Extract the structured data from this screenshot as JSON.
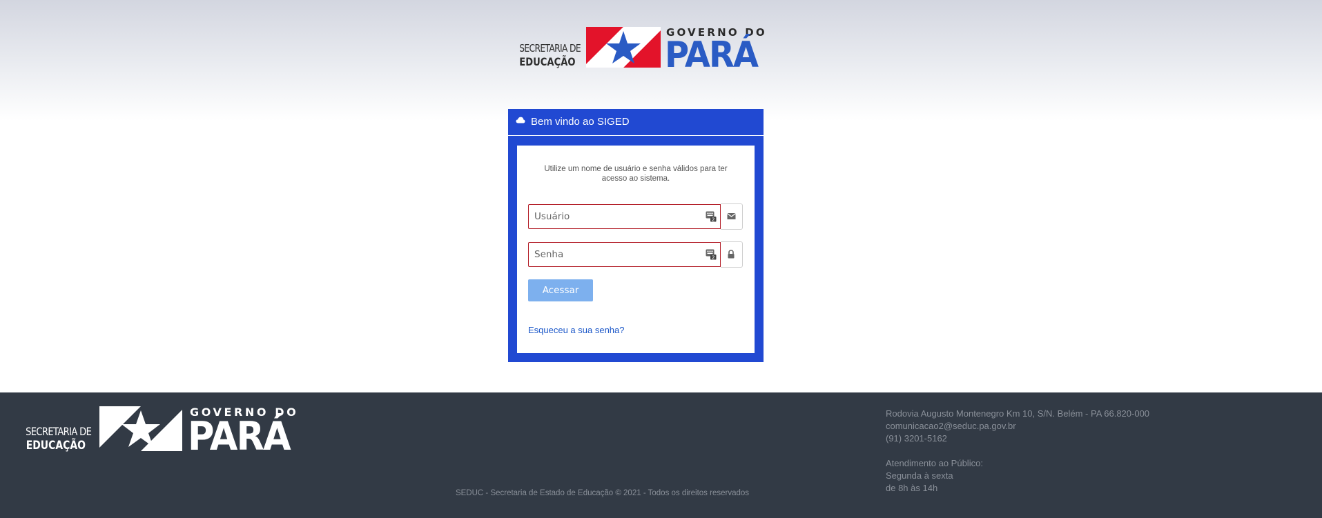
{
  "header": {
    "org_line1": "SECRETARIA DE",
    "org_line2": "EDUCAÇÃO",
    "gov_small": "GOVERNO DO",
    "gov_big": "PARÁ"
  },
  "login": {
    "title": "Bem vindo ao SIGED",
    "intro": "Utilize um nome de usuário e senha válidos para ter acesso ao sistema.",
    "username_placeholder": "Usuário",
    "password_placeholder": "Senha",
    "submit_label": "Acessar",
    "forgot_link": "Esqueceu a sua senha?"
  },
  "footer": {
    "org_line1": "SECRETARIA DE",
    "org_line2": "EDUCAÇÃO",
    "gov_small": "GOVERNO DO",
    "gov_big": "PARÁ",
    "address": "Rodovia Augusto Montenegro Km 10, S/N. Belém - PA 66.820-000",
    "email": "comunicacao2@seduc.pa.gov.br",
    "phone": "(91) 3201-5162",
    "hours_title": "Atendimento ao Público:",
    "hours_days": "Segunda à sexta",
    "hours_time": "de 8h às 14h",
    "copyright": "SEDUC - Secretaria de Estado de Educação © 2021 - Todos os direitos reservados"
  },
  "colors": {
    "panel": "#2149d2",
    "button": "#7db0ee",
    "field_border": "#b4202a",
    "footer_bg": "#323a45",
    "brand_blue": "#2a5bc4",
    "flag_red": "#e3132a"
  },
  "icons": [
    "cloud-icon",
    "keyboard-icon",
    "envelope-icon",
    "lock-icon",
    "para-flag-icon"
  ]
}
